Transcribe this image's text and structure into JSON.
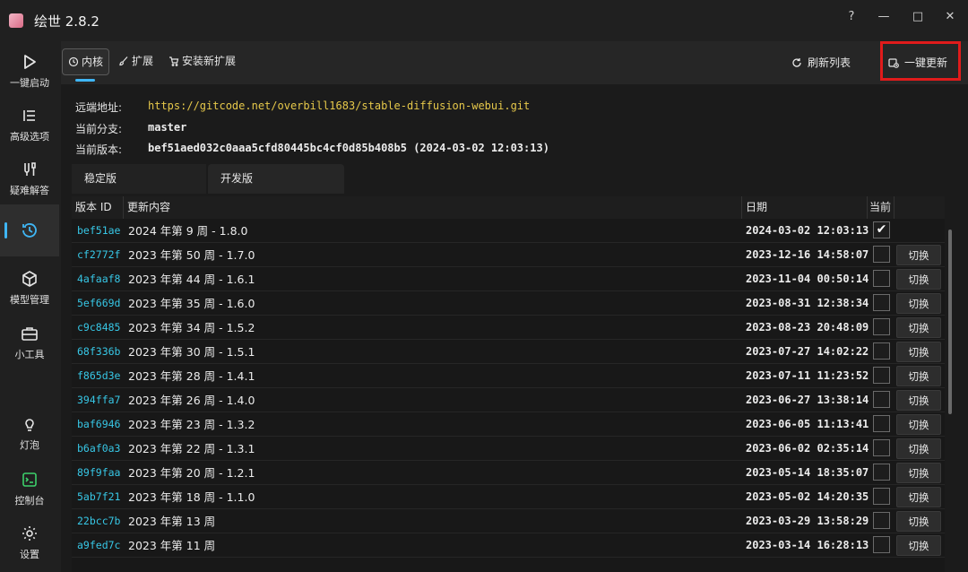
{
  "window": {
    "title": "绘世 2.8.2",
    "help": "?",
    "minimize": "—",
    "maximize": "□",
    "close": "✕"
  },
  "sidebar": {
    "items": [
      {
        "label": "一键启动",
        "icon": "play-icon"
      },
      {
        "label": "高级选项",
        "icon": "list-options-icon"
      },
      {
        "label": "疑难解答",
        "icon": "tools-icon"
      },
      {
        "label": "",
        "icon": "history-icon",
        "active": true
      },
      {
        "label": "模型管理",
        "icon": "cube-icon"
      },
      {
        "label": "小工具",
        "icon": "toolbox-icon"
      },
      {
        "label": "灯泡",
        "icon": "lightbulb-icon"
      },
      {
        "label": "控制台",
        "icon": "console-icon"
      },
      {
        "label": "设置",
        "icon": "gear-icon"
      }
    ]
  },
  "tabs": [
    {
      "label": "内核",
      "icon": "history-icon",
      "active": true
    },
    {
      "label": "扩展",
      "icon": "brush-icon"
    },
    {
      "label": "安装新扩展",
      "icon": "cart-icon"
    }
  ],
  "actions": {
    "refresh": "刷新列表",
    "update_all": "一键更新"
  },
  "info": {
    "remote_label": "远端地址:",
    "remote_value": "https://gitcode.net/overbill1683/stable-diffusion-webui.git",
    "branch_label": "当前分支:",
    "branch_value": "master",
    "version_label": "当前版本:",
    "version_value": "bef51aed032c0aaa5cfd80445bc4cf0d85b408b5 (2024-03-02 12:03:13)"
  },
  "subtabs": {
    "stable": "稳定版",
    "dev": "开发版"
  },
  "table": {
    "headers": {
      "id": "版本 ID",
      "content": "更新内容",
      "date": "日期",
      "current": "当前"
    },
    "switch_label": "切换",
    "rows": [
      {
        "id": "bef51ae",
        "content": "2024 年第 9 周 - 1.8.0",
        "date": "2024-03-02 12:03:13",
        "current": true
      },
      {
        "id": "cf2772f",
        "content": "2023 年第 50 周 - 1.7.0",
        "date": "2023-12-16 14:58:07",
        "current": false
      },
      {
        "id": "4afaaf8",
        "content": "2023 年第 44 周 - 1.6.1",
        "date": "2023-11-04 00:50:14",
        "current": false
      },
      {
        "id": "5ef669d",
        "content": "2023 年第 35 周 - 1.6.0",
        "date": "2023-08-31 12:38:34",
        "current": false
      },
      {
        "id": "c9c8485",
        "content": "2023 年第 34 周 - 1.5.2",
        "date": "2023-08-23 20:48:09",
        "current": false
      },
      {
        "id": "68f336b",
        "content": "2023 年第 30 周 - 1.5.1",
        "date": "2023-07-27 14:02:22",
        "current": false
      },
      {
        "id": "f865d3e",
        "content": "2023 年第 28 周 - 1.4.1",
        "date": "2023-07-11 11:23:52",
        "current": false
      },
      {
        "id": "394ffa7",
        "content": "2023 年第 26 周 - 1.4.0",
        "date": "2023-06-27 13:38:14",
        "current": false
      },
      {
        "id": "baf6946",
        "content": "2023 年第 23 周 - 1.3.2",
        "date": "2023-06-05 11:13:41",
        "current": false
      },
      {
        "id": "b6af0a3",
        "content": "2023 年第 22 周 - 1.3.1",
        "date": "2023-06-02 02:35:14",
        "current": false
      },
      {
        "id": "89f9faa",
        "content": "2023 年第 20 周 - 1.2.1",
        "date": "2023-05-14 18:35:07",
        "current": false
      },
      {
        "id": "5ab7f21",
        "content": "2023 年第 18 周 - 1.1.0",
        "date": "2023-05-02 14:20:35",
        "current": false
      },
      {
        "id": "22bcc7b",
        "content": "2023 年第 13 周",
        "date": "2023-03-29 13:58:29",
        "current": false
      },
      {
        "id": "a9fed7c",
        "content": "2023 年第 11 周",
        "date": "2023-03-14 16:28:13",
        "current": false
      }
    ]
  },
  "colors": {
    "accent": "#3fb6f5",
    "remote_url": "#e6c84a",
    "version_id": "#37c7e6",
    "highlight_border": "#e01b1b"
  }
}
